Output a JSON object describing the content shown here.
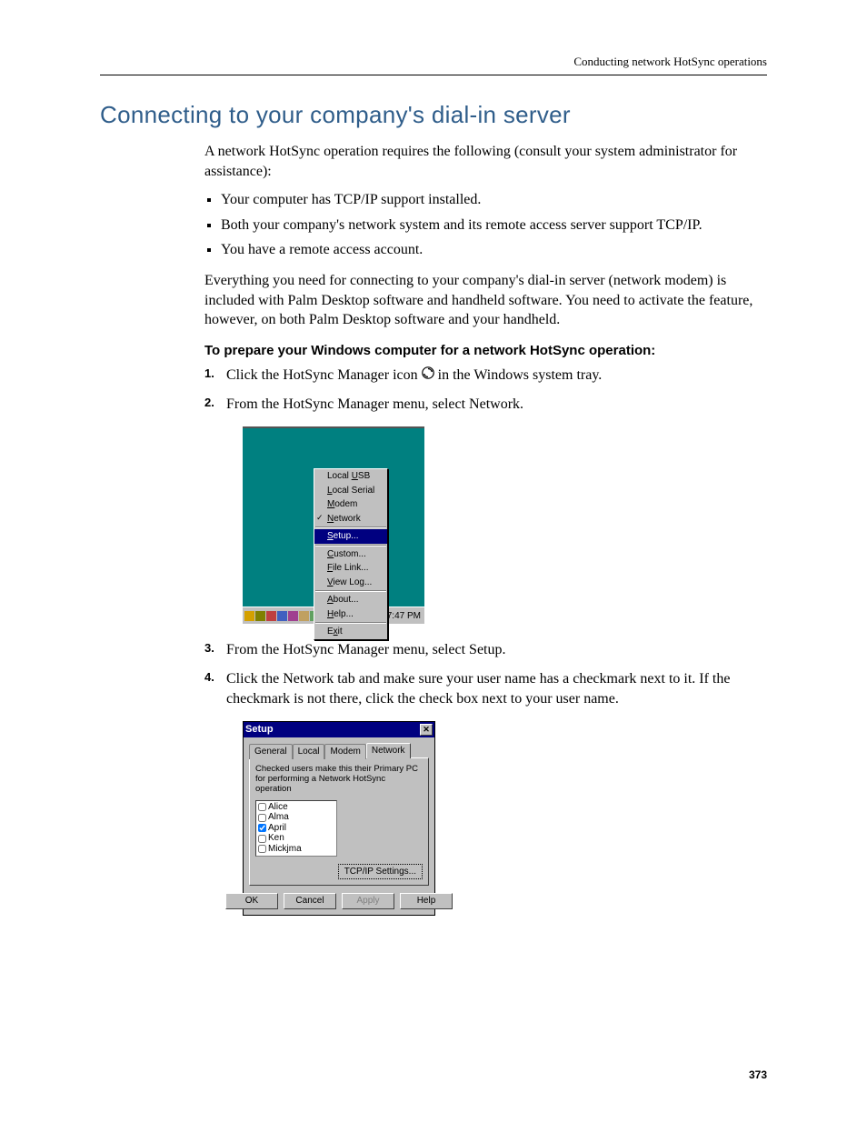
{
  "header": {
    "running_head": "Conducting network HotSync operations"
  },
  "title": "Connecting to your company's dial-in server",
  "intro": "A network HotSync operation requires the following (consult your system administrator for assistance):",
  "requirements": [
    "Your computer has TCP/IP support installed.",
    "Both your company's network system and its remote access server support TCP/IP.",
    "You have a remote access account."
  ],
  "para_everything": "Everything you need for connecting to your company's dial-in server (network modem) is included with Palm Desktop software and handheld software. You need to activate the feature, however, on both Palm Desktop software and your handheld.",
  "subhead": "To prepare your Windows computer for a network HotSync operation:",
  "steps": {
    "s1_pre": "Click the HotSync Manager icon ",
    "s1_post": " in the Windows system tray.",
    "s2": "From the HotSync Manager menu, select Network.",
    "s3": "From the HotSync Manager menu, select Setup.",
    "s4": "Click the Network tab and make sure your user name has a checkmark next to it. If the checkmark is not there, click the check box next to your user name."
  },
  "menu": {
    "items": [
      {
        "label": "Local USB",
        "u": "U"
      },
      {
        "label": "Local Serial",
        "u": "L"
      },
      {
        "label": "Modem",
        "u": "M"
      },
      {
        "label": "Network",
        "u": "N",
        "checked": true
      },
      {
        "sep": true
      },
      {
        "label": "Setup...",
        "u": "S",
        "selected": true
      },
      {
        "sep": true
      },
      {
        "label": "Custom...",
        "u": "C"
      },
      {
        "label": "File Link...",
        "u": "F"
      },
      {
        "label": "View Log...",
        "u": "V"
      },
      {
        "sep": true
      },
      {
        "label": "About...",
        "u": "A"
      },
      {
        "label": "Help...",
        "u": "H"
      },
      {
        "sep": true
      },
      {
        "label": "Exit",
        "u": "x"
      }
    ],
    "clock": "7:47 PM"
  },
  "dialog": {
    "title": "Setup",
    "tabs": [
      "General",
      "Local",
      "Modem",
      "Network"
    ],
    "active_tab": 3,
    "instruction": "Checked users make this their Primary PC for performing a Network HotSync operation",
    "users": [
      {
        "name": "Alice",
        "checked": false
      },
      {
        "name": "Alma",
        "checked": false
      },
      {
        "name": "April",
        "checked": true
      },
      {
        "name": "Ken",
        "checked": false
      },
      {
        "name": "Mickjma",
        "checked": false
      }
    ],
    "tcpip_btn": "TCP/IP Settings...",
    "buttons": {
      "ok": "OK",
      "cancel": "Cancel",
      "apply": "Apply",
      "help": "Help"
    }
  },
  "page_number": "373"
}
